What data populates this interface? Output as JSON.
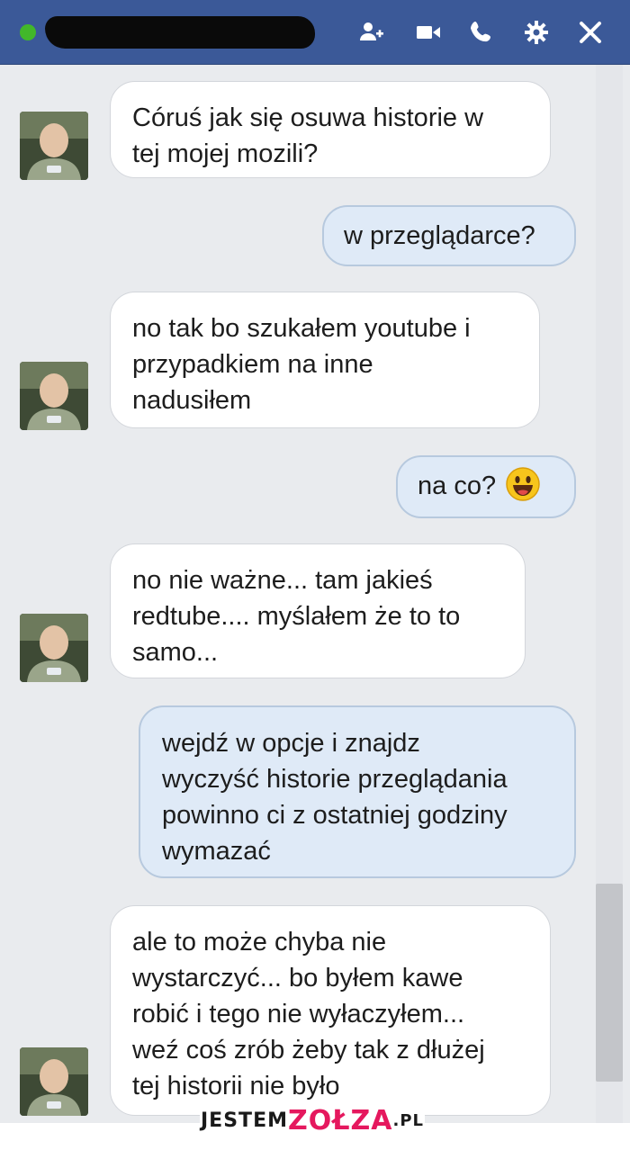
{
  "header": {
    "icons": [
      "add-person-icon",
      "video-call-icon",
      "phone-call-icon",
      "settings-gear-icon",
      "close-icon"
    ],
    "background_color": "#3b5998",
    "online_color": "#42b72a"
  },
  "messages": [
    {
      "side": "in",
      "lines": [
        "Córuś jak się osuwa historie w",
        "tej mojej mozili?"
      ]
    },
    {
      "side": "out",
      "lines": [
        "w przeglądarce?"
      ]
    },
    {
      "side": "in",
      "lines": [
        "no tak bo szukałem youtube i",
        "przypadkiem na inne",
        "nadusiłem"
      ]
    },
    {
      "side": "out",
      "lines": [
        "na co?"
      ],
      "emoji": "smiley-emoji-icon"
    },
    {
      "side": "in",
      "lines": [
        "no nie ważne... tam jakieś",
        "redtube.... myślałem że to to",
        "samo..."
      ]
    },
    {
      "side": "out",
      "lines": [
        "wejdź w opcje i znajdz",
        "wyczyść historie przeglądania",
        "powinno ci z ostatniej godziny",
        "wymazać"
      ]
    },
    {
      "side": "in",
      "lines": [
        "ale to może chyba nie",
        "wystarczyć... bo byłem kawe",
        "robić i tego nie wyłaczyłem...",
        "weź coś zrób żeby tak z dłużej",
        "tej historii nie było"
      ]
    }
  ],
  "watermark": {
    "part1": "JESTEM",
    "part2": "ZOŁZA",
    "part3": ".PL"
  },
  "colors": {
    "incoming_bubble": "#ffffff",
    "outgoing_bubble": "#dfeaf7",
    "chat_background": "#e9ebee"
  }
}
